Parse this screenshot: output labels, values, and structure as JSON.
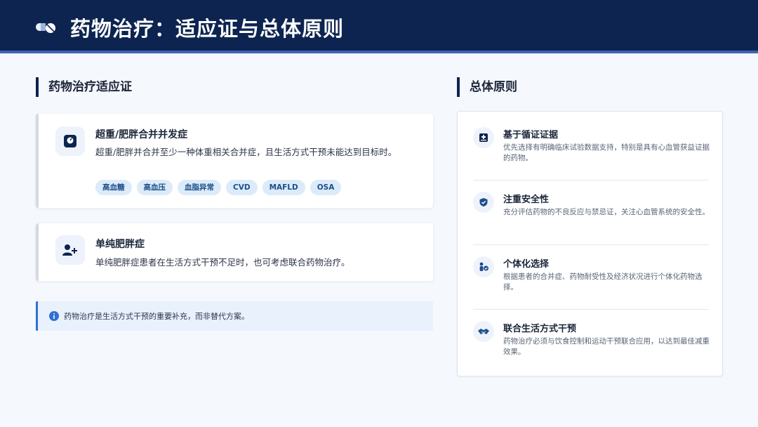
{
  "header": {
    "title": "药物治疗：适应证与总体原则",
    "icon": "pills-icon"
  },
  "left": {
    "heading": "药物治疗适应证",
    "cards": [
      {
        "icon": "weight-scale-icon",
        "title": "超重/肥胖合并并发症",
        "desc": "超重/肥胖并合并至少一种体重相关合并症，且生活方式干预未能达到目标时。",
        "tags": [
          "高血糖",
          "高血压",
          "血脂异常",
          "CVD",
          "MAFLD",
          "OSA"
        ]
      },
      {
        "icon": "user-plus-icon",
        "title": "单纯肥胖症",
        "desc": "单纯肥胖症患者在生活方式干预不足时，也可考虑联合药物治疗。"
      }
    ],
    "note": {
      "icon": "info-icon",
      "text": "药物治疗是生活方式干预的重要补充，而非替代方案。"
    }
  },
  "right": {
    "heading": "总体原则",
    "items": [
      {
        "icon": "medical-file-icon",
        "title": "基于循证证据",
        "desc": "优先选择有明确临床试验数据支持，特别是具有心血管获益证据的药物。"
      },
      {
        "icon": "shield-icon",
        "title": "注重安全性",
        "desc": "充分评估药物的不良反应与禁忌证，关注心血管系统的安全性。"
      },
      {
        "icon": "person-check-icon",
        "title": "个体化选择",
        "desc": "根据患者的合并症、药物耐受性及经济状况进行个体化药物选择。"
      },
      {
        "icon": "handshake-icon",
        "title": "联合生活方式干预",
        "desc": "药物治疗必须与饮食控制和运动干预联合应用，以达到最佳减重效果。"
      }
    ]
  },
  "colors": {
    "header_bg": "#0d2450",
    "accent": "#2f6fd6",
    "tag_bg": "#dcebf9"
  }
}
